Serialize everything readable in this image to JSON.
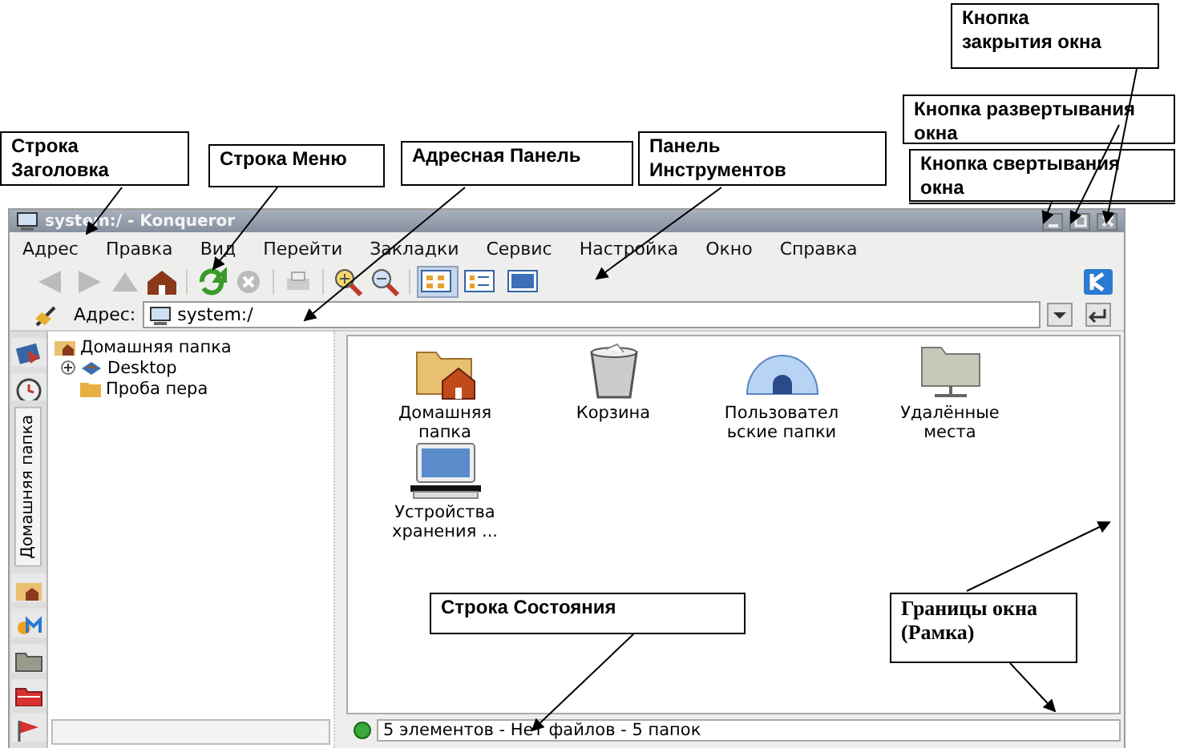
{
  "window": {
    "title": "system:/ - Konqueror"
  },
  "menu": [
    "Адрес",
    "Правка",
    "Вид",
    "Перейти",
    "Закладки",
    "Сервис",
    "Настройка",
    "Окно",
    "Справка"
  ],
  "address": {
    "label": "Адрес:",
    "value": "system:/"
  },
  "sidebar": {
    "tab": "Домашняя папка"
  },
  "tree": [
    {
      "label": "Домашняя папка",
      "children": [
        {
          "label": "Desktop",
          "kind": "expandable"
        },
        {
          "label": "Проба пера",
          "kind": "leaf"
        }
      ]
    }
  ],
  "icons": [
    {
      "label": "Домашняя папка",
      "kind": "home"
    },
    {
      "label": "Корзина",
      "kind": "trash"
    },
    {
      "label": "Пользовател ьские папки",
      "kind": "igloo"
    },
    {
      "label": "Удалённые места",
      "kind": "remote"
    },
    {
      "label": "Устройства хранения ...",
      "kind": "storage"
    }
  ],
  "status_bar": "5 элементов - Нет файлов - 5 папок",
  "callouts": [
    "Строка Заголовка",
    "Строка Меню",
    "Адресная Панель",
    "Панель Инструментов",
    "Кнопка закрытия окна",
    "Кнопка развертывания окна",
    "Кнопка свертывания окна",
    "Строка Состояния",
    "Границы окна (Рамка)"
  ]
}
